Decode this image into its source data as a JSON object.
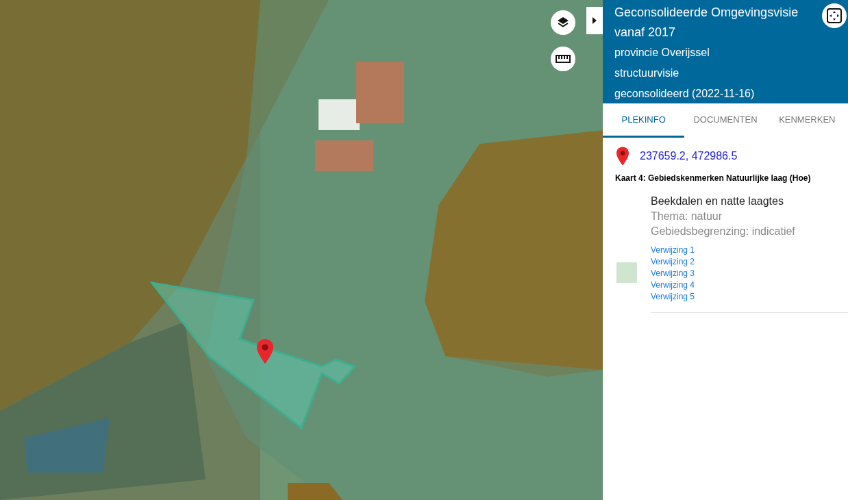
{
  "header": {
    "title": "Geconsolideerde Omgevingsvisie vanaf 2017",
    "lines": [
      "provincie Overijssel",
      "structuurvisie",
      "geconsolideerd (2022-11-16)"
    ]
  },
  "tabs": [
    {
      "label": "PLEKINFO",
      "selected": true
    },
    {
      "label": "DOCUMENTEN",
      "selected": false
    },
    {
      "label": "KENMERKEN",
      "selected": false
    }
  ],
  "location": {
    "coordinates": "237659.2, 472986.5"
  },
  "layer": {
    "title": "Kaart 4: Gebiedskenmerken Natuurlijke laag (Hoe)"
  },
  "feature": {
    "name": "Beekdalen en natte laagtes",
    "details": [
      "Thema: natuur",
      "Gebiedsbegrenzing: indicatief"
    ],
    "color": "#cfe5d0",
    "links": [
      "Verwijzing 1",
      "Verwijzing 2",
      "Verwijzing 3",
      "Verwijzing 4",
      "Verwijzing 5"
    ]
  }
}
